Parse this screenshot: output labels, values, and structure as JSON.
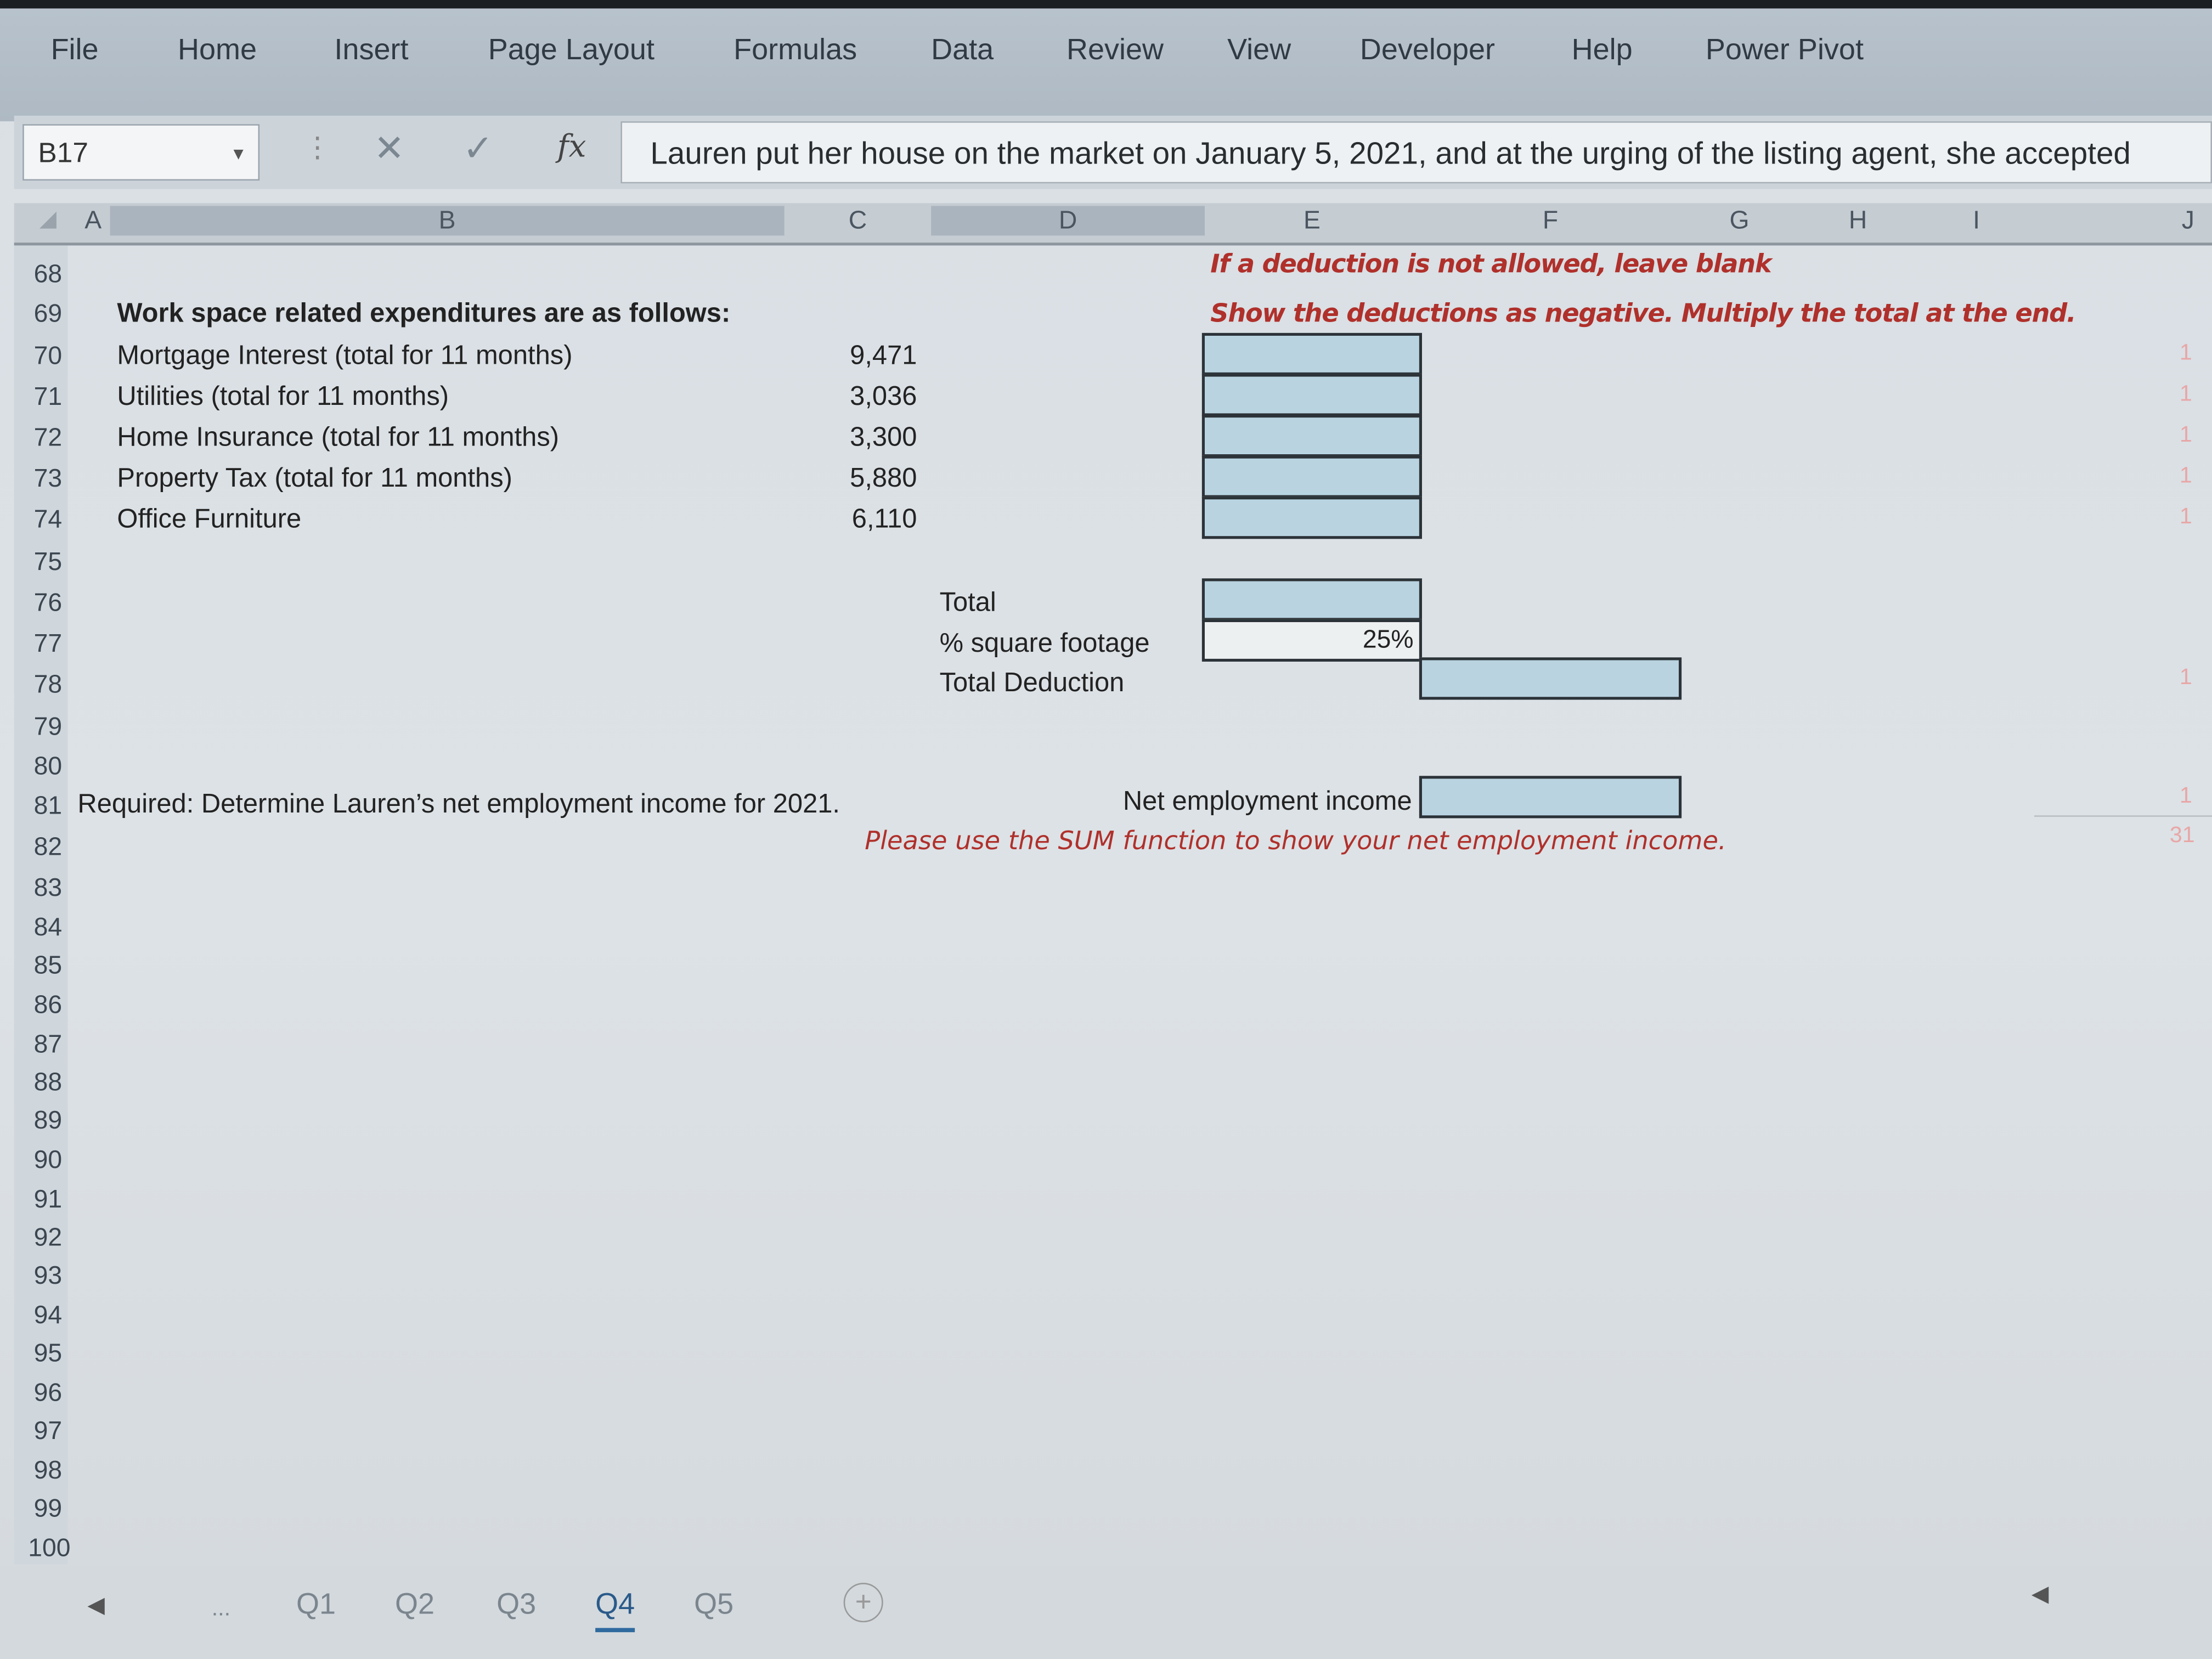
{
  "ribbon": {
    "tabs": [
      "File",
      "Home",
      "Insert",
      "Page Layout",
      "Formulas",
      "Data",
      "Review",
      "View",
      "Developer",
      "Help",
      "Power Pivot"
    ]
  },
  "formula_bar": {
    "name_box": "B17",
    "fx": "fx",
    "content": "Lauren put her house on the market on January 5, 2021, and at the urging of the listing agent, she accepted"
  },
  "columns": [
    "A",
    "B",
    "C",
    "D",
    "E",
    "F",
    "G",
    "H",
    "I",
    "J"
  ],
  "rows": [
    "68",
    "69",
    "70",
    "71",
    "72",
    "73",
    "74",
    "75",
    "76",
    "77",
    "78",
    "79",
    "80",
    "81",
    "82",
    "83",
    "84",
    "85",
    "86",
    "87",
    "88",
    "89",
    "90",
    "91",
    "92",
    "93",
    "94",
    "95",
    "96",
    "97",
    "98",
    "99",
    "100"
  ],
  "notes": {
    "leave_blank": "If a deduction is not allowed, leave blank",
    "negative": "Show the deductions as negative.  Multiply the total at the end."
  },
  "expenses": {
    "heading": "Work space related expenditures are as follows:",
    "items": [
      {
        "label": "Mortgage Interest (total for 11 months)",
        "value": "9,471"
      },
      {
        "label": "Utilities (total for 11 months)",
        "value": "3,036"
      },
      {
        "label": "Home Insurance (total for 11 months)",
        "value": "3,300"
      },
      {
        "label": "Property Tax  (total for 11 months)",
        "value": "5,880"
      },
      {
        "label": "Office Furniture",
        "value": "6,110"
      }
    ]
  },
  "summary": {
    "total_label": "Total",
    "sqft_label": "% square footage",
    "sqft_value": "25%",
    "deduction_label": "Total Deduction"
  },
  "required": {
    "text": "Required:  Determine Lauren’s net employment income for 2021.",
    "net_label": "Net employment income",
    "sum_note": "Please use the SUM function to show your net employment income."
  },
  "right_margin": [
    "1",
    "1",
    "1",
    "1",
    "1",
    "1",
    "1",
    "31"
  ],
  "sheets": {
    "ellipsis": "...",
    "tabs": [
      "Q1",
      "Q2",
      "Q3",
      "Q4",
      "Q5"
    ],
    "active": "Q4"
  }
}
